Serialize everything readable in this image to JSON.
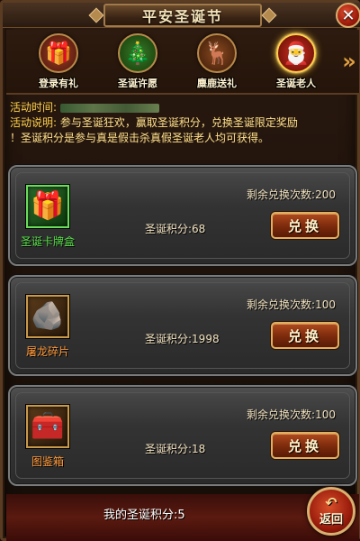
{
  "window": {
    "title": "平安圣诞节",
    "close_icon": "✕"
  },
  "tabs": [
    {
      "label": "登录有礼",
      "icon": "🎁",
      "bg": "#7a2a18",
      "active": false
    },
    {
      "label": "圣诞许愿",
      "icon": "🎄",
      "bg": "#2a5a1a",
      "active": false
    },
    {
      "label": "麋鹿送礼",
      "icon": "🦌",
      "bg": "#6a3a18",
      "active": false
    },
    {
      "label": "圣诞老人",
      "icon": "🎅",
      "bg": "#a02018",
      "active": true
    }
  ],
  "info": {
    "time_label": "活动时间:",
    "desc_label": "活动说明:",
    "desc_text": "参与圣诞狂欢，赢取圣诞积分，兑换圣诞限定奖励",
    "desc_text2": "！圣诞积分是参与真是假击杀真假圣诞老人均可获得。"
  },
  "rewards": [
    {
      "name": "圣诞卡牌盒",
      "name_color": "#5ae04a",
      "icon": "🎁",
      "points": "圣诞积分:68",
      "remaining": "剩余兑换次数:200",
      "button": "兑换"
    },
    {
      "name": "屠龙碎片",
      "name_color": "#ff9a3a",
      "icon": "🪨",
      "points": "圣诞积分:1998",
      "remaining": "剩余兑换次数:100",
      "button": "兑换"
    },
    {
      "name": "图鉴箱",
      "name_color": "#ff9a3a",
      "icon": "🧰",
      "points": "圣诞积分:18",
      "remaining": "剩余兑换次数:100",
      "button": "兑换"
    }
  ],
  "footer": {
    "my_points": "我的圣诞积分:5",
    "back_label": "返回"
  }
}
